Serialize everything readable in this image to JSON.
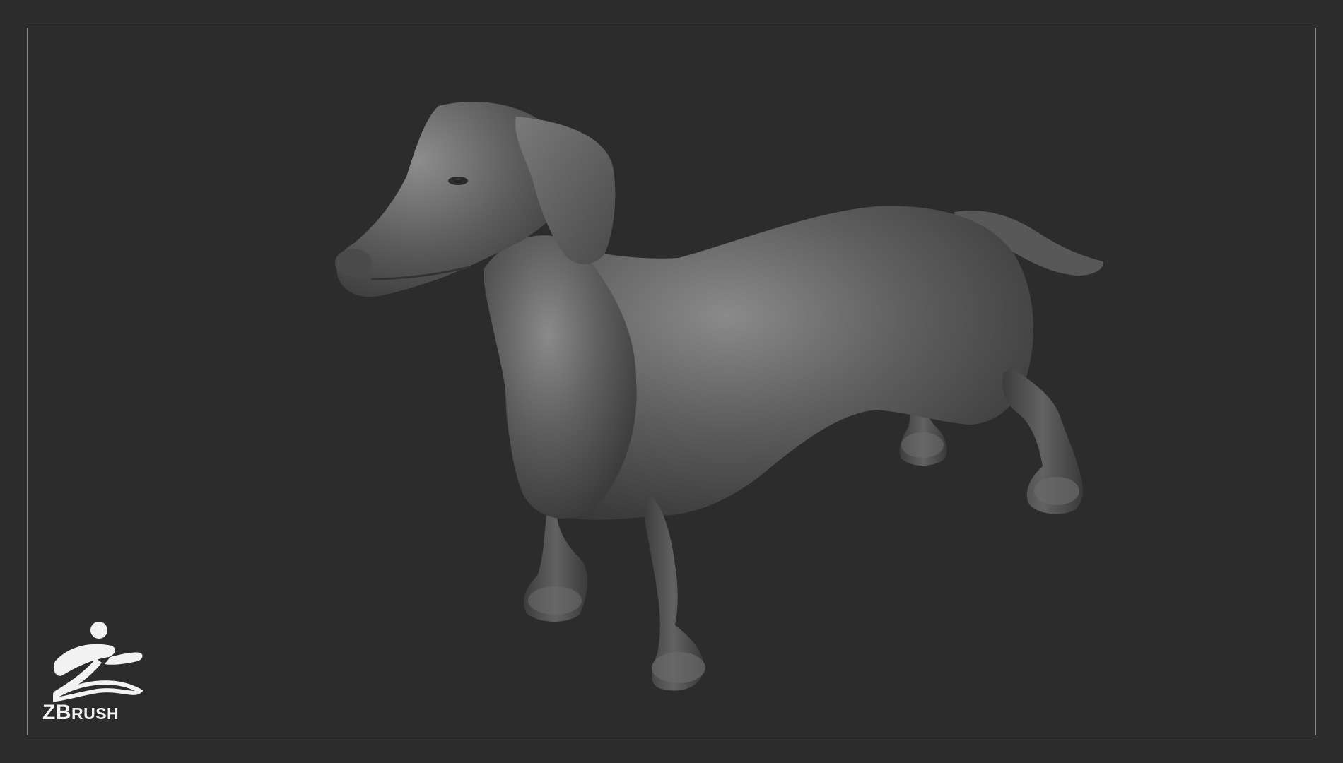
{
  "scene": {
    "subject": "dachshund-sculpt",
    "background_color": "#2c2c2c",
    "frame_color": "#8a8a8a",
    "clay_color": "#5e5e5e"
  },
  "logo": {
    "icon": "zbrush-figure-icon",
    "text_big": "ZB",
    "text_small": "RUSH"
  }
}
